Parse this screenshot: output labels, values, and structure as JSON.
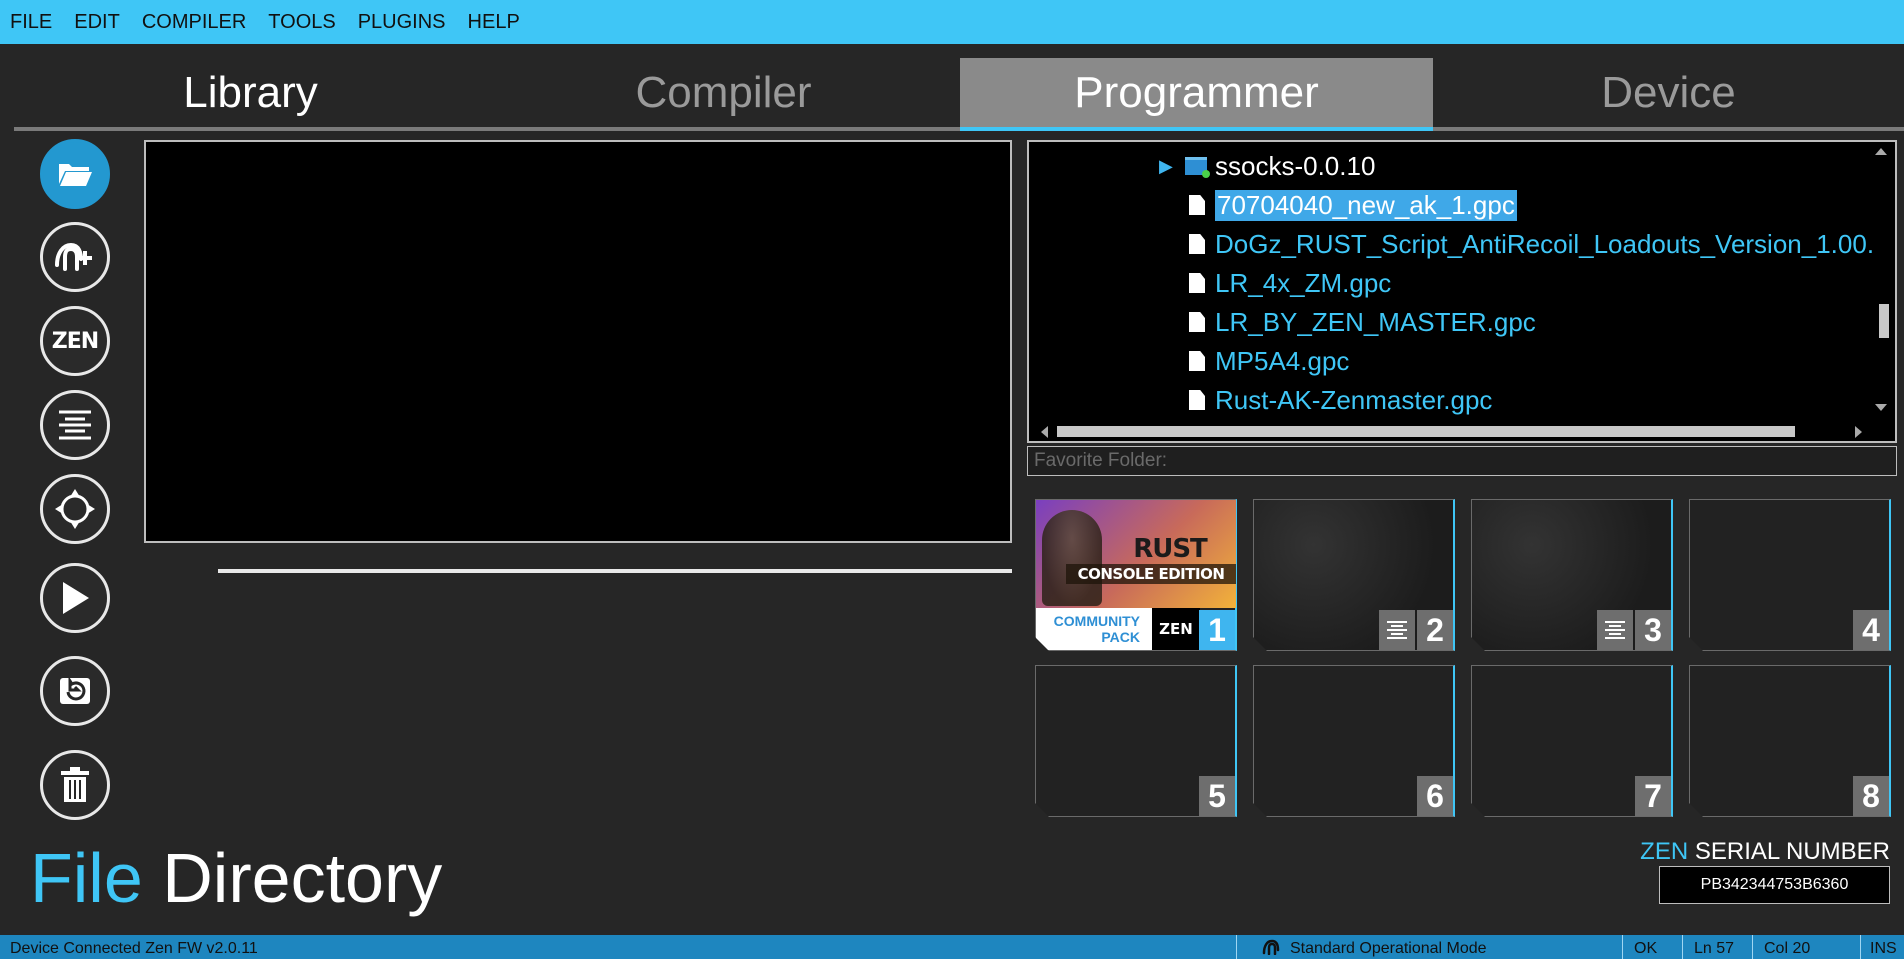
{
  "menu": [
    "FILE",
    "EDIT",
    "COMPILER",
    "TOOLS",
    "PLUGINS",
    "HELP"
  ],
  "tabs": {
    "library": "Library",
    "compiler": "Compiler",
    "programmer": "Programmer",
    "device": "Device"
  },
  "side_buttons": [
    "open-folder-icon",
    "new-script-icon",
    "zen-icon",
    "align-icon",
    "target-icon",
    "play-icon",
    "restore-icon",
    "trash-icon"
  ],
  "side_zen_text": "ZEN",
  "tree": {
    "folder": "ssocks-0.0.10",
    "files": [
      "70704040_new_ak_1.gpc",
      "DoGz_RUST_Script_AntiRecoil_Loadouts_Version_1.00.",
      "LR_4x_ZM.gpc",
      "LR_BY_ZEN_MASTER.gpc",
      "MP5A4.gpc",
      "Rust-AK-Zenmaster.gpc"
    ],
    "selected_index": 0
  },
  "favorite_placeholder": "Favorite Folder:",
  "slots": {
    "numbers": [
      "1",
      "2",
      "3",
      "4",
      "5",
      "6",
      "7",
      "8"
    ],
    "slot1": {
      "title": "RUST",
      "subtitle": "CONSOLE EDITION",
      "community_1": "COMMUNITY",
      "community_2": "PACK",
      "zen": "ZEN"
    }
  },
  "footer": {
    "file": "File",
    "directory": "Directory"
  },
  "serial": {
    "zen": "ZEN",
    "label": "SERIAL NUMBER",
    "value": "PB342344753B6360"
  },
  "status": {
    "device": "Device Connected Zen FW v2.0.11",
    "mode": "Standard Operational Mode",
    "ok": "OK",
    "line": "Ln 57",
    "col": "Col 20",
    "ins": "INS"
  },
  "colors": {
    "accent": "#3fc6f6",
    "background": "#262626",
    "statusbar": "#1e86bf"
  }
}
